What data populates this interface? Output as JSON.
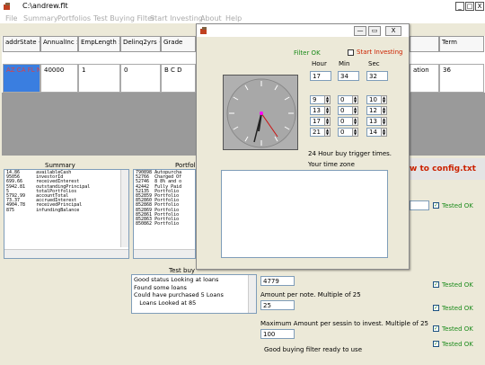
{
  "window": {
    "title": "C:\\andrew.flt",
    "min_label": "_",
    "max_label": "□",
    "close_label": "X"
  },
  "menu": [
    "File",
    "Summary",
    "Portfolios",
    "Test Buying Filter",
    "Start Investing",
    "About",
    "Help"
  ],
  "grid": {
    "headers": [
      "addrState <>",
      "AnnualInc >=",
      "EmpLength >=",
      "Delinq2yrs <=",
      "Grade",
      "",
      "Term"
    ],
    "row": [
      "AZ CA FL NV",
      "40000",
      "1",
      "0",
      "B C D",
      "C",
      "ation",
      "36"
    ]
  },
  "banner": "w to config.txt",
  "summary": {
    "heading": "Summary",
    "lines": [
      "14.86      availableCash",
      "95056      investorId",
      "699.66     receivedInterest",
      "5942.81    outstandingPrincipal",
      "5          totalPortfolios",
      "5792.99    accountTotal",
      "73.37      accruedInterest",
      "4904.78    receivedPrincipal",
      "875        infundingBalance"
    ]
  },
  "portfolios": {
    "heading": "Portfoli",
    "lines": [
      "790898 Autopurcha",
      "52766  Charged Of",
      "52746  8 8% and o",
      "42442  Fully Paid",
      "52135  Portfolio ",
      "852859 Portfolio ",
      "852860 Portfolio ",
      "852868 Portfolio ",
      "852869 Portfolio ",
      "852861 Portfolio ",
      "852863 Portfolio ",
      "850862 Portfolio "
    ]
  },
  "test_buy": {
    "heading": "Test buy",
    "lines": [
      "Good status Looking at loans",
      "Found some loans",
      "Could have purchased 5 Loans",
      "   Loans Looked at 85"
    ]
  },
  "right_panel": {
    "field1_value": "4779",
    "amount_per_note_label": "Amount per note. Multiple of 25",
    "amount_per_note_value": "25",
    "max_amount_label": "Maximum Amount per sessin to invest. Multiple of 25",
    "max_amount_value": "100",
    "ready_label": "Good buying filter ready to use",
    "tested_ok": "Tested OK"
  },
  "dialog": {
    "filter_ok": "Filter OK",
    "start_investing": "Start Investing",
    "hour_label": "Hour",
    "min_label": "Min",
    "sec_label": "Sec",
    "hour": "17",
    "min": "34",
    "sec": "32",
    "triggers": [
      {
        "h": "9",
        "m": "0",
        "s": "10"
      },
      {
        "h": "13",
        "m": "0",
        "s": "12"
      },
      {
        "h": "17",
        "m": "0",
        "s": "13"
      },
      {
        "h": "21",
        "m": "0",
        "s": "14"
      }
    ],
    "trigger_caption": "24 Hour buy trigger times.",
    "timezone_label": "Your time zone",
    "min_btn": "—",
    "max_btn": "▭",
    "close_btn": "X",
    "colors": {
      "accent_green": "#1a8a1a",
      "banner_red": "#cc2200"
    }
  }
}
